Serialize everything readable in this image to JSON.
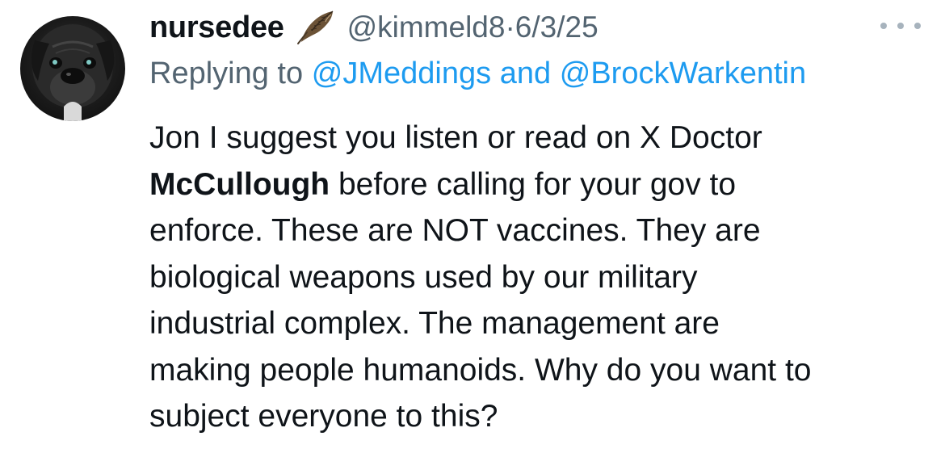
{
  "tweet": {
    "display_name": "nursedee",
    "name_icon": "feather-icon",
    "handle": "@kimmeld8",
    "separator": "·",
    "date": "6/3/25",
    "more_icon": "more-dots-icon",
    "reply": {
      "prefix": "Replying to",
      "mention_1": "@JMeddings",
      "conjunction": "and",
      "mention_2": "@BrockWarkentin"
    },
    "body": {
      "line_1": "Jon I suggest you listen or read on X Doctor",
      "line_2_bold": "McCullough",
      "line_2_rest": " before calling for your gov to",
      "line_3": "enforce. These are NOT vaccines. They are",
      "line_4": "biological weapons used by our military",
      "line_5": "industrial complex. The management are",
      "line_6": "making people humanoids. Why do you want to",
      "line_7": "subject everyone to this?"
    }
  },
  "colors": {
    "text_primary": "#0f1419",
    "text_secondary": "#536471",
    "link": "#1d9bf0",
    "more_dots": "#a7b3bd"
  }
}
